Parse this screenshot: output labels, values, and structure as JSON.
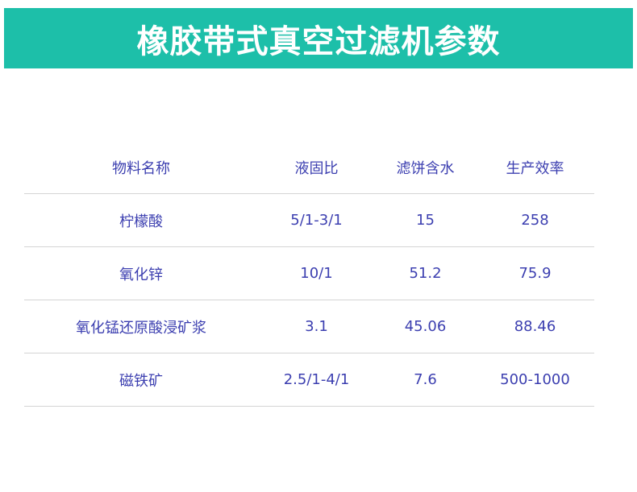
{
  "title": "橡胶带式真空过滤机参数",
  "table": {
    "headers": [
      "物料名称",
      "液固比",
      "滤饼含水",
      "生产效率"
    ],
    "rows": [
      [
        "柠檬酸",
        "5/1-3/1",
        "15",
        "258"
      ],
      [
        "氧化锌",
        "10/1",
        "51.2",
        "75.9"
      ],
      [
        "氧化锰还原酸浸矿浆",
        "3.1",
        "45.06",
        "88.46"
      ],
      [
        "磁铁矿",
        "2.5/1-4/1",
        "7.6",
        "500-1000"
      ]
    ]
  },
  "colors": {
    "banner": "#1dbfa9",
    "title_text": "#ffffff",
    "table_text": "#3c3fb0",
    "divider": "#d4d4d4"
  }
}
